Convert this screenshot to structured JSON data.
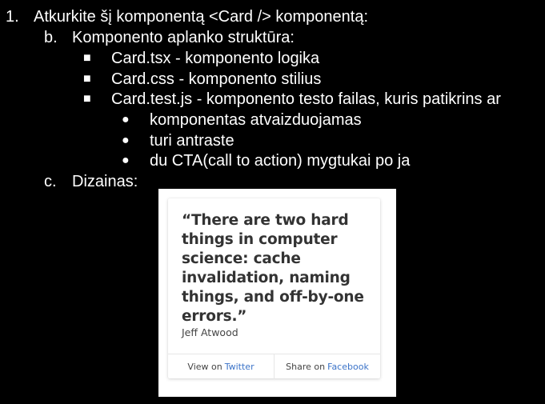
{
  "outline": {
    "item1": {
      "marker": "1.",
      "text": "Atkurkite šį komponentą <Card /> komponentą:"
    },
    "item_b": {
      "marker": "b.",
      "text": "Komponento aplanko struktūra:"
    },
    "files": [
      {
        "marker": "■",
        "text": "Card.tsx - komponento logika"
      },
      {
        "marker": "■",
        "text": "Card.css - komponento stilius"
      },
      {
        "marker": "■",
        "text": "Card.test.js - komponento testo failas, kuris patikrins ar"
      }
    ],
    "checks": [
      {
        "marker": "●",
        "text": "komponentas atvaizduojamas"
      },
      {
        "marker": "●",
        "text": "turi antraste"
      },
      {
        "marker": "●",
        "text": "du CTA(call to action) mygtukai po ja"
      }
    ],
    "item_c": {
      "marker": "c.",
      "text": "Dizainas:"
    }
  },
  "card": {
    "quote": "“There are two hard\nthings in computer\nscience: cache\ninvalidation, naming\nthings, and off-by-one\nerrors.”",
    "author": "Jeff Atwood",
    "buttons": [
      {
        "prefix": "View on",
        "link": "Twitter"
      },
      {
        "prefix": "Share on",
        "link": "Facebook"
      }
    ],
    "colors": {
      "link": "#3b73c8",
      "quote": "#333333"
    }
  }
}
